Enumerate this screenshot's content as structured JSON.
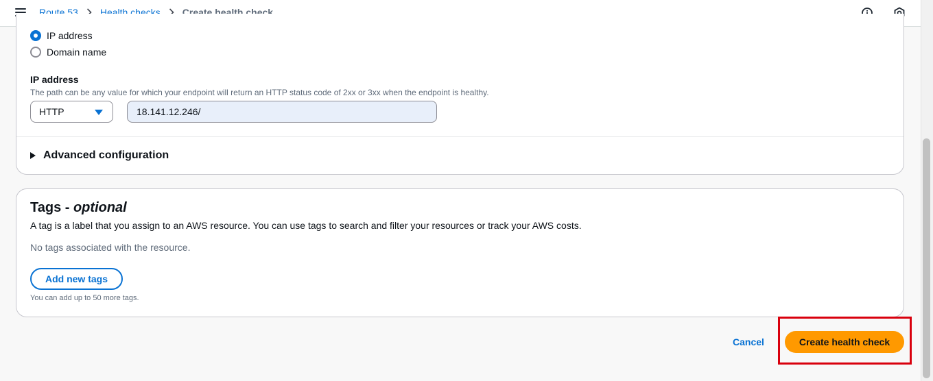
{
  "breadcrumb": {
    "items": [
      "Route 53",
      "Health checks"
    ],
    "current": "Create health check"
  },
  "endpoint": {
    "options": [
      {
        "label": "IP address",
        "checked": true
      },
      {
        "label": "Domain name",
        "checked": false
      }
    ],
    "field_label": "IP address",
    "field_description": "The path can be any value for which your endpoint will return an HTTP status code of 2xx or 3xx when the endpoint is healthy.",
    "protocol": "HTTP",
    "ip_value": "18.141.12.246/",
    "advanced_label": "Advanced configuration"
  },
  "tags": {
    "title": "Tags - ",
    "title_optional": "optional",
    "description": "A tag is a label that you assign to an AWS resource. You can use tags to search and filter your resources or track your AWS costs.",
    "empty_text": "No tags associated with the resource.",
    "add_button": "Add new tags",
    "hint": "You can add up to 50 more tags."
  },
  "actions": {
    "cancel": "Cancel",
    "submit": "Create health check"
  },
  "colors": {
    "accent": "#0972d3",
    "primary_button": "#ff9900",
    "highlight": "#d9000d"
  },
  "icons": {
    "menu": "hamburger-menu-icon",
    "breadcrumb_separator": "chevron-right-icon",
    "info": "info-icon",
    "settings": "hexagon-settings-icon"
  }
}
